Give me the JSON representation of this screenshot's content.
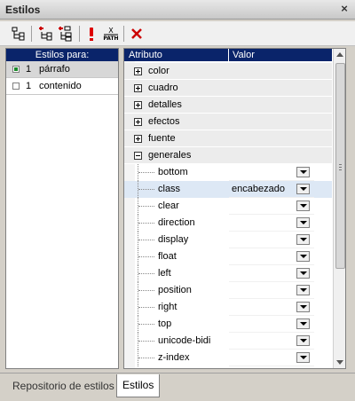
{
  "window": {
    "title": "Estilos",
    "close_label": "×"
  },
  "toolbar": {
    "icons": [
      "tree-structure-icon",
      "add-style-icon",
      "add-style-multi-icon",
      "important-icon",
      "xpath-icon",
      "delete-icon"
    ],
    "xpath_label": "PATH"
  },
  "styles_for": {
    "header": "Estilos para:",
    "rows": [
      {
        "checked": true,
        "count": "1",
        "name": "párrafo"
      },
      {
        "checked": false,
        "count": "1",
        "name": "contenido"
      }
    ]
  },
  "properties": {
    "col_attr": "Atributo",
    "col_value": "Valor",
    "groups": [
      {
        "label": "color",
        "expanded": false
      },
      {
        "label": "cuadro",
        "expanded": false
      },
      {
        "label": "detalles",
        "expanded": false
      },
      {
        "label": "efectos",
        "expanded": false
      },
      {
        "label": "fuente",
        "expanded": false
      },
      {
        "label": "generales",
        "expanded": true
      }
    ],
    "generales_props": [
      {
        "name": "bottom",
        "value": ""
      },
      {
        "name": "class",
        "value": "encabezado"
      },
      {
        "name": "clear",
        "value": ""
      },
      {
        "name": "direction",
        "value": ""
      },
      {
        "name": "display",
        "value": ""
      },
      {
        "name": "float",
        "value": ""
      },
      {
        "name": "left",
        "value": ""
      },
      {
        "name": "position",
        "value": ""
      },
      {
        "name": "right",
        "value": ""
      },
      {
        "name": "top",
        "value": ""
      },
      {
        "name": "unicode-bidi",
        "value": ""
      },
      {
        "name": "z-index",
        "value": ""
      }
    ]
  },
  "tabs": [
    {
      "label": "Repositorio de estilos",
      "active": false
    },
    {
      "label": "Estilos",
      "active": true
    }
  ]
}
